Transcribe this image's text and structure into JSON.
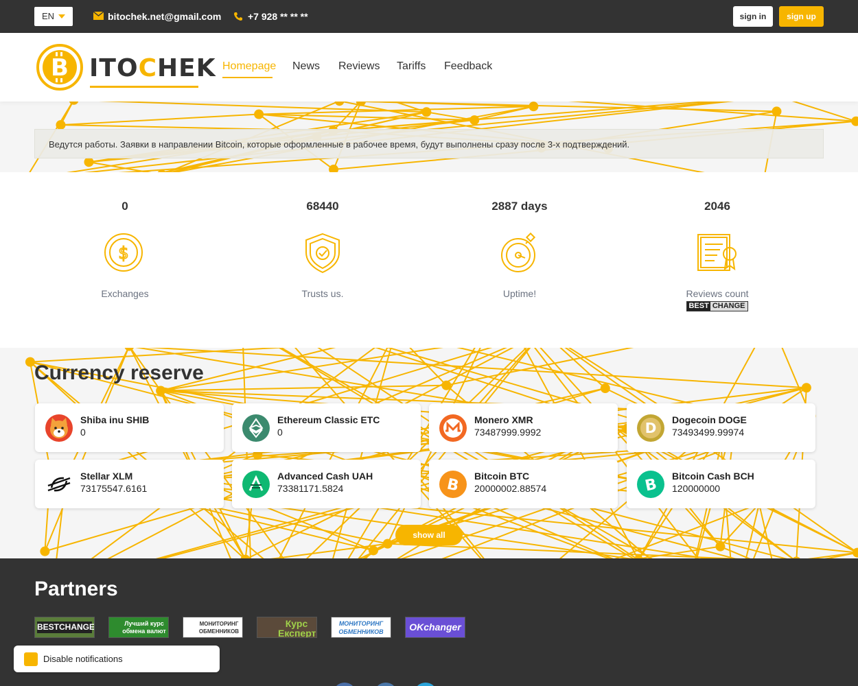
{
  "topbar": {
    "lang": "EN",
    "email": "bitochek.net@gmail.com",
    "phone": "+7 928 ** ** **",
    "signin": "sign in",
    "signup": "sign up"
  },
  "header": {
    "logo_text_1": "ITO",
    "logo_text_2": "C",
    "logo_text_3": "HEK",
    "nav": [
      "Homepage",
      "News",
      "Reviews",
      "Tariffs",
      "Feedback"
    ]
  },
  "notice": "Ведутся работы. Заявки в направлении Bitcoin, которые оформленные в рабочее время, будут выполнены сразу после 3-х подтверждений.",
  "stats": [
    {
      "value": "0",
      "label": "Exchanges",
      "icon": "dollar-coin-icon"
    },
    {
      "value": "68440",
      "label": "Trusts us.",
      "icon": "shield-check-icon"
    },
    {
      "value": "2887 days",
      "label": "Uptime!",
      "icon": "stopwatch-icon"
    },
    {
      "value": "2046",
      "label": "Reviews count",
      "icon": "certificate-icon"
    }
  ],
  "bestchange_badge": {
    "part1": "BEST",
    "part2": "CHANGE"
  },
  "reserve": {
    "title": "Currency reserve",
    "items": [
      {
        "name": "Shiba inu SHIB",
        "amount": "0",
        "icon": "shiba-icon",
        "color": "#e8442b"
      },
      {
        "name": "Ethereum Classic ETC",
        "amount": "0",
        "icon": "ethereum-classic-icon",
        "color": "#3b8a6e"
      },
      {
        "name": "Monero XMR",
        "amount": "73487999.9992",
        "icon": "monero-icon",
        "color": "#f26822"
      },
      {
        "name": "Dogecoin DOGE",
        "amount": "73493499.99974",
        "icon": "dogecoin-icon",
        "color": "#c2a633"
      },
      {
        "name": "Stellar XLM",
        "amount": "73175547.6161",
        "icon": "stellar-icon",
        "color": "#111111"
      },
      {
        "name": "Advanced Cash UAH",
        "amount": "73381171.5824",
        "icon": "advcash-icon",
        "color": "#0fb872"
      },
      {
        "name": "Bitcoin BTC",
        "amount": "20000002.88574",
        "icon": "bitcoin-icon",
        "color": "#f7931a"
      },
      {
        "name": "Bitcoin Cash BCH",
        "amount": "120000000",
        "icon": "bitcoin-cash-icon",
        "color": "#0ac18e"
      }
    ],
    "show_all": "show all"
  },
  "footer": {
    "partners_title": "Partners",
    "partners": [
      {
        "name": "BESTCHANGE",
        "bg": "#5a7d3a",
        "fg": "#ffffff"
      },
      {
        "name": "Лучший курс обмена валют",
        "bg": "#2e8b2e",
        "fg": "#ffffff"
      },
      {
        "name": "МОНИТОРИНГ ОБМЕННИКОВ",
        "bg": "#ffffff",
        "fg": "#333333"
      },
      {
        "name": "Курс Експерт",
        "bg": "#5b4a3a",
        "fg": "#9fd04a"
      },
      {
        "name": "МОНИТОРИНГ ОБМЕННИКОВ",
        "bg": "#ffffff",
        "fg": "#2f78c4"
      },
      {
        "name": "OKchanger",
        "bg": "#6a4fd6",
        "fg": "#ffffff"
      }
    ]
  },
  "notification": "Disable notifications",
  "colors": {
    "accent": "#f7b500",
    "dark": "#333333"
  }
}
